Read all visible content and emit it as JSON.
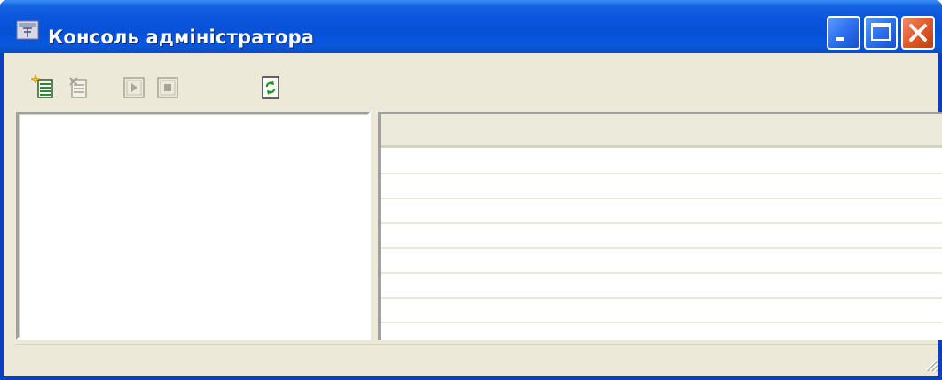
{
  "window": {
    "title": "Консоль адміністратора",
    "colors": {
      "titlebar": "#0651d6",
      "close": "#e15a2a",
      "face": "#ece9d8"
    }
  },
  "caption_buttons": [
    "minimize-icon",
    "maximize-icon",
    "close-icon"
  ],
  "toolbar": {
    "buttons": [
      {
        "icon": "new-item-icon",
        "enabled": true
      },
      {
        "icon": "delete-item-icon",
        "enabled": false
      },
      {
        "icon": "start-icon",
        "enabled": false
      },
      {
        "icon": "stop-icon",
        "enabled": false
      },
      {
        "icon": "refresh-icon",
        "enabled": true
      }
    ]
  },
  "list": {
    "columns": [],
    "rows": []
  },
  "statusbar": {
    "text": ""
  }
}
